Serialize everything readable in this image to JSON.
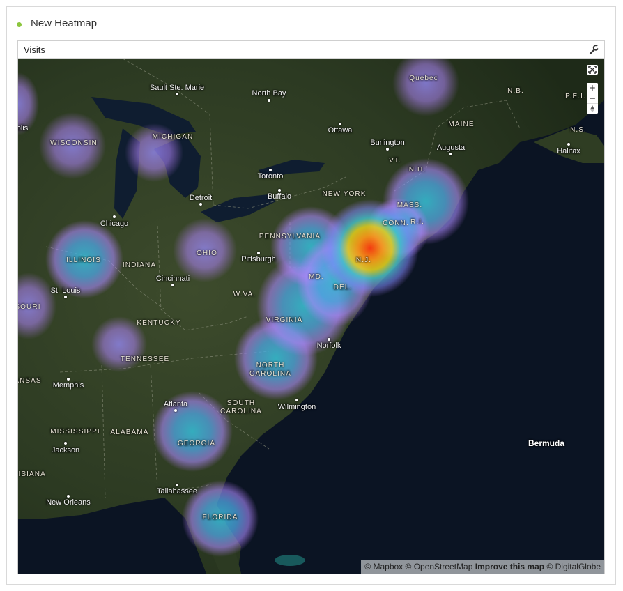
{
  "panel": {
    "title": "New Heatmap",
    "status_color": "#8cc63e"
  },
  "widget": {
    "title": "Visits",
    "settings_icon": "wrench-icon"
  },
  "map": {
    "controls": {
      "fullscreen": "fullscreen-icon",
      "zoom_in": "+",
      "zoom_out": "−",
      "compass": "compass-icon"
    },
    "attribution": {
      "mapbox": "© Mapbox",
      "osm": "© OpenStreetMap",
      "improve": "Improve this map",
      "digitalglobe": "© DigitalGlobe"
    },
    "cities": [
      {
        "name": "Sault Ste. Marie"
      },
      {
        "name": "North Bay"
      },
      {
        "name": "Ottawa"
      },
      {
        "name": "Burlington"
      },
      {
        "name": "Augusta"
      },
      {
        "name": "Halifax"
      },
      {
        "name": "Toronto"
      },
      {
        "name": "Buffalo"
      },
      {
        "name": "Detroit"
      },
      {
        "name": "Chicago"
      },
      {
        "name": "Pittsburgh"
      },
      {
        "name": "Cincinnati"
      },
      {
        "name": "St. Louis"
      },
      {
        "name": "Norfolk"
      },
      {
        "name": "Memphis"
      },
      {
        "name": "Atlanta"
      },
      {
        "name": "Wilmington"
      },
      {
        "name": "Jackson"
      },
      {
        "name": "New Orleans"
      },
      {
        "name": "Tallahassee"
      },
      {
        "name": "olis"
      }
    ],
    "regions": [
      {
        "name": "Quebec"
      },
      {
        "name": "N.B."
      },
      {
        "name": "P.E.I."
      },
      {
        "name": "MAINE"
      },
      {
        "name": "N.S."
      },
      {
        "name": "VT."
      },
      {
        "name": "N.H."
      },
      {
        "name": "MASS."
      },
      {
        "name": "CONN."
      },
      {
        "name": "R.I."
      },
      {
        "name": "N.J."
      },
      {
        "name": "NEW YORK"
      },
      {
        "name": "WISCONSIN"
      },
      {
        "name": "MICHIGAN"
      },
      {
        "name": "PENNSYLVANIA"
      },
      {
        "name": "OHIO"
      },
      {
        "name": "ILLINOIS"
      },
      {
        "name": "INDIANA"
      },
      {
        "name": "MD."
      },
      {
        "name": "DEL."
      },
      {
        "name": "W.VA."
      },
      {
        "name": "SOURI"
      },
      {
        "name": "KENTUCKY"
      },
      {
        "name": "VIRGINIA"
      },
      {
        "name": "TENNESSEE"
      },
      {
        "name": "NORTH\nCAROLINA"
      },
      {
        "name": "ANSAS"
      },
      {
        "name": "SOUTH\nCAROLINA"
      },
      {
        "name": "MISSISSIPPI"
      },
      {
        "name": "ALABAMA"
      },
      {
        "name": "GEORGIA"
      },
      {
        "name": "UISIANA"
      },
      {
        "name": "FLORIDA"
      }
    ],
    "islands": [
      {
        "name": "Bermuda"
      }
    ]
  }
}
